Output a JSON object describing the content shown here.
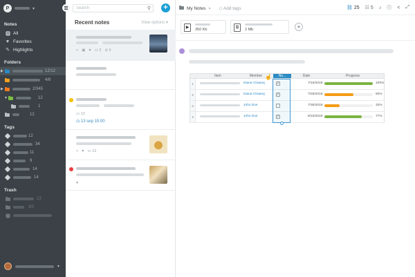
{
  "sidebar": {
    "workspace_initial": "P",
    "notes_section": "Notes",
    "notes_items": [
      {
        "label": "All",
        "icon": "notes-icon"
      },
      {
        "label": "Favorites",
        "icon": "heart-icon"
      },
      {
        "label": "Highlights",
        "icon": "highlight-icon"
      }
    ],
    "folders_section": "Folders",
    "folders": [
      {
        "count": "12/12",
        "color": "#2a8ac4"
      },
      {
        "count": "4/8",
        "color": "#f0a020"
      },
      {
        "count": "2/345",
        "color": "#f07a20"
      },
      {
        "count": "12",
        "color": "#7cc043"
      },
      {
        "count": "1",
        "color": "#b8bec3"
      },
      {
        "count": "12",
        "color": "#b8bec3"
      }
    ],
    "tags_section": "Tags",
    "tags": [
      {
        "count": "12"
      },
      {
        "count": "34"
      },
      {
        "count": "11"
      },
      {
        "count": "9"
      },
      {
        "count": "14"
      },
      {
        "count": "14"
      }
    ],
    "trash_section": "Trash",
    "trash": [
      {
        "count": "23"
      },
      {
        "count": "3/5"
      },
      {
        "count": ""
      }
    ]
  },
  "notes_list": {
    "search_placeholder": "Search",
    "add_label": "+",
    "heading": "Recent notes",
    "view_options": "View options",
    "notes": [
      {
        "meta_a": "2",
        "meta_b": "5",
        "dot": ""
      },
      {
        "meta_a": "",
        "meta_b": "",
        "dot": ""
      },
      {
        "count": "12",
        "date": "13 sep 15:00",
        "dot": "#f5c000"
      },
      {
        "meta_a": "12",
        "dot": ""
      },
      {
        "meta_a": "",
        "dot": "#e84040"
      }
    ]
  },
  "editor": {
    "breadcrumb": "My Notes",
    "add_tags": "Add tags",
    "shared_count": "25",
    "tasks_count": "5",
    "attachments": [
      {
        "size": "350 Kb",
        "type_icon": "video-file-icon"
      },
      {
        "size": "2 Mb",
        "type_icon": "zip-file-icon"
      }
    ],
    "table": {
      "headers": [
        "Item",
        "Member",
        "Ne...",
        "Date",
        "Progress"
      ],
      "rows": [
        {
          "num": "1",
          "member": "Diana Chaaraj",
          "checked": true,
          "date": "7/15/2019",
          "progress": 100,
          "color": "#7cb342",
          "pct": "100%"
        },
        {
          "num": "2",
          "member": "Diana Chaaraj",
          "checked": true,
          "date": "7/26/2019",
          "progress": 60,
          "color": "#f39c12",
          "pct": "60%"
        },
        {
          "num": "3",
          "member": "John Doe",
          "checked": false,
          "date": "7/30/2019",
          "progress": 32,
          "color": "#f39c12",
          "pct": "32%"
        },
        {
          "num": "4",
          "member": "John Doe",
          "checked": true,
          "date": "8/15/2019",
          "progress": 77,
          "color": "#7cb342",
          "pct": "77%"
        }
      ]
    }
  }
}
